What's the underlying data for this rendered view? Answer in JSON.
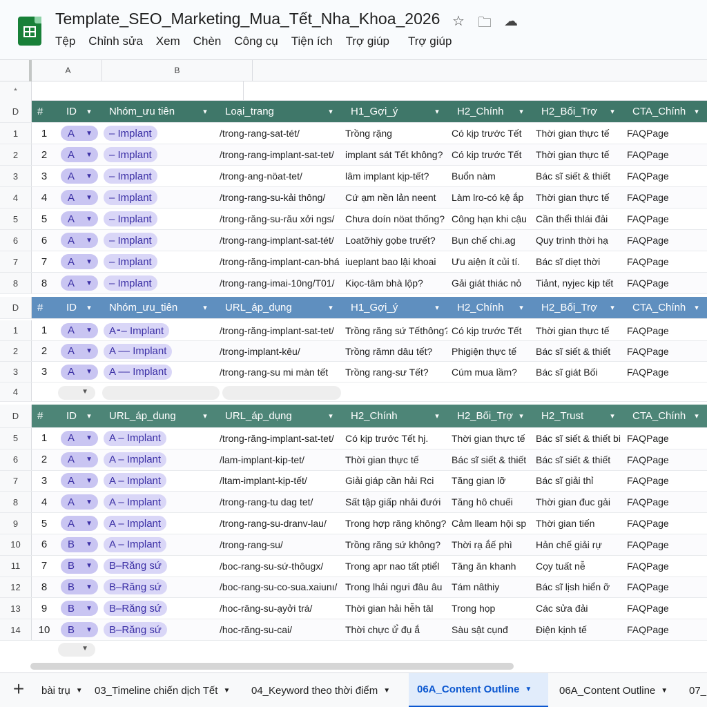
{
  "app": {
    "doc_title": "Template_SEO_Marketing_Mua_Tết_Nha_Khoa_2026",
    "icons": [
      "star-icon",
      "move-folder-icon",
      "cloud-status-icon"
    ],
    "menu": [
      "Tệp",
      "Chỉnh sửa",
      "Xem",
      "Chèn",
      "Công cụ",
      "Tiện ích",
      "Trợ giúp",
      "Trợ giúp"
    ]
  },
  "column_headers": [
    "A",
    "B"
  ],
  "freeze_row": {
    "label": "*"
  },
  "sections": [
    {
      "header_row_label": "D",
      "headers": [
        "#",
        "ID",
        "Nhóm_ưu tiên",
        "Loại_trang",
        "H1_Gợi_ý",
        "H2_Chính",
        "H2_Bối_Trợ",
        "CTA_Chính"
      ],
      "rows": [
        {
          "rn": "1",
          "n": "1",
          "id": "A",
          "grp": "– Implant",
          "url": "/trong-rang-sat-tét/",
          "c1": "Trồng rặng",
          "c2": "Có kịp trước Tết",
          "c3": "Thời gian thực tế",
          "cta": "FAQPage"
        },
        {
          "rn": "2",
          "n": "2",
          "id": "A",
          "grp": "– Implant",
          "url": "/trong-rang-implant-sat-tet/",
          "c1": "implant sát Tết không?",
          "c2": "Có kịp trước Tết",
          "c3": "Thời gian thực tế",
          "cta": "FAQPage"
        },
        {
          "rn": "3",
          "n": "3",
          "id": "A",
          "grp": "– Implant",
          "url": "/trong-ang-nöat-tet/",
          "c1": "lâm implant kịp-tết?",
          "c2": "Buổn nàm",
          "c3": "Bác sĩ siết & thiết",
          "cta": "FAQPage"
        },
        {
          "rn": "4",
          "n": "4",
          "id": "A",
          "grp": "– Implant",
          "url": "/trong-rang-su-kải thông/",
          "c1": "Cứ ạm nền lản neent",
          "c2": "Làm lro-có kệ ắp",
          "c3": "Thời gian thực tế",
          "cta": "FAQPage"
        },
        {
          "rn": "5",
          "n": "5",
          "id": "A",
          "grp": "– Implant",
          "url": "/trong-răng-su-rău xởi ngs/",
          "c1": "Chưa doín nöat thống?",
          "c2": "Công hạn khi cậu",
          "c3": "Cần thểi thlái đải",
          "cta": "FAQPage"
        },
        {
          "rn": "6",
          "n": "6",
          "id": "A",
          "grp": "– Implant",
          "url": "/trong-rang-implant-sat-tét/",
          "c1": "Loatỡhiy gọbe trưết?",
          "c2": "Bụn chế chi.ag",
          "c3": "Quy trình thời hạ",
          "cta": "FAQPage"
        },
        {
          "rn": "7",
          "n": "7",
          "id": "A",
          "grp": "– Implant",
          "url": "/trong-răng-implant-can-bhá",
          "c1": "iueplant bao lậi khoai",
          "c2": "Ưu aiện ít củi tí.",
          "c3": "Bác sĩ diẹt thời",
          "cta": "FAQPage"
        },
        {
          "rn": "8",
          "n": "8",
          "id": "A",
          "grp": "– Implant",
          "url": "/trong-rang-imai-10ng/T01/",
          "c1": "Kiọc-tâm bhà lộp?",
          "c2": "Gải giát thiác nỏ",
          "c3": "Tiảnt, nyjec kịp tết",
          "cta": "FAQPage"
        }
      ]
    },
    {
      "header_row_label": "D",
      "headers": [
        "#",
        "ID",
        "Nhóm_ưu_tiên",
        "URL_áp_dụng",
        "H1_Gợi_ý",
        "H2_Chính",
        "H2_Bối_Trợ",
        "CTA_Chính"
      ],
      "rows": [
        {
          "rn": "1",
          "n": "1",
          "id": "A",
          "grp": "A⁃– Implant",
          "url": "/trong-răng-implant-sat-tet/",
          "c1": "Trồng răng sứ Tếthông?",
          "c2": "Có kịp trước Tết",
          "c3": "Thời gian thực tế",
          "cta": "FAQPage"
        },
        {
          "rn": "2",
          "n": "2",
          "id": "A",
          "grp": "A –– Implant",
          "url": "/trong-implant-kêu/",
          "c1": "Trồng rămn dâu tết?",
          "c2": "Phigiện thực tế",
          "c3": "Bác sĩ siết & thiết",
          "cta": "FAQPage"
        },
        {
          "rn": "3",
          "n": "3",
          "id": "A",
          "grp": "A –– Implant",
          "url": "/trong-rang-su mi màn tết",
          "c1": "Trồng rang-sư Tết?",
          "c2": "Cúm mua lầm?",
          "c3": "Bác sĩ giát Bối",
          "cta": "FAQPage"
        }
      ],
      "empty_row_label": "4"
    },
    {
      "header_row_label": "D",
      "headers": [
        "#",
        "ID",
        "URL_áp_dung",
        "URL_áp_dụng",
        "H2_Chính",
        "H2_Bối_Trợ",
        "H2_Trust",
        "CTA_Chính"
      ],
      "rows": [
        {
          "rn": "5",
          "n": "1",
          "id": "A",
          "grp": "A – Implant",
          "url": "/trong-răng-implant-sat-tet/",
          "c1": "Có kịp trước Tết hj.",
          "c2": "Thời gian thực tế",
          "c3": "Bác sĩ siết & thiết bi",
          "cta": "FAQPage"
        },
        {
          "rn": "6",
          "n": "2",
          "id": "A",
          "grp": "A – Implant",
          "url": "/lam-implant-kip-tet/",
          "c1": "Thời gian thực tế",
          "c2": "Bác sĩ siết & thiết",
          "c3": "Bác sĩ siết & thiết",
          "cta": "FAQPage"
        },
        {
          "rn": "7",
          "n": "3",
          "id": "A",
          "grp": "A – Implant",
          "url": "/ltam-implant-kịp-tết/",
          "c1": "Giải giáp cần hải Rci",
          "c2": "Tăng gian lỡ",
          "c3": "Bác sĩ giải thỉ",
          "cta": "FAQPage"
        },
        {
          "rn": "8",
          "n": "4",
          "id": "A",
          "grp": "A – Implant",
          "url": "/trong-rang-tu dag tet/",
          "c1": "Sất tập giấp nhải đưới",
          "c2": "Tăng hô chuếi",
          "c3": "Thời gian đuc gải",
          "cta": "FAQPage"
        },
        {
          "rn": "9",
          "n": "5",
          "id": "A",
          "grp": "A – Implant",
          "url": "/trong-rang-su-dranv-lau/",
          "c1": "Trong hợp răng không?",
          "c2": "Cảm lleam hội sp",
          "c3": "Thời gian tiến",
          "cta": "FAQPage"
        },
        {
          "rn": "10",
          "n": "6",
          "id": "B",
          "grp": "A – Implant",
          "url": "/trong-rang-su/",
          "c1": "Trồng răng sứ không?",
          "c2": "Thời rạ ắế phì",
          "c3": "Hản chế giải rự",
          "cta": "FAQPage"
        },
        {
          "rn": "11",
          "n": "7",
          "id": "B",
          "grp": "B–Răng sứ",
          "url": "/boc-rang-su-sứ-thôugx/",
          "c1": "Trong apr nao tất ptiểl",
          "c2": "Tăng ăn khanh",
          "c3": "Cọy tuất nễ",
          "cta": "FAQPage"
        },
        {
          "rn": "12",
          "n": "8",
          "id": "B",
          "grp": "B–Răng sứ",
          "url": "/boc-rang-su-co-sua.xaiunı/",
          "c1": "Trong lhải ngưi đâu âu",
          "c2": "Tám nâthiy",
          "c3": "Bác sĩ lịsh hiển ỡ",
          "cta": "FAQPage"
        },
        {
          "rn": "13",
          "n": "9",
          "id": "B",
          "grp": "B–Răng sứ",
          "url": "/hoc-răng-su-ạyởi trá/",
          "c1": "Thời gian hải hễh tâl",
          "c2": "Trong họp",
          "c3": "Các sửa đải",
          "cta": "FAQPage"
        },
        {
          "rn": "14",
          "n": "10",
          "id": "B",
          "grp": "B–Răng sứ",
          "url": "/hoc-răng-su-cai/",
          "c1": "Thời chực ử̉ đụ ắ",
          "c2": "Sàu sật cụnđ",
          "c3": "Điện kịnh tế",
          "cta": "FAQPage"
        }
      ]
    }
  ],
  "tabs": [
    {
      "label": "bài trụ",
      "active": false
    },
    {
      "label": "03_Timeline chiến dịch Tết",
      "active": false
    },
    {
      "label": "04_Keyword theo thời điểm",
      "active": false
    },
    {
      "label": "06A_Content Outline",
      "active": true
    },
    {
      "label": "06A_Content Outline",
      "active": false
    },
    {
      "label": "07_",
      "active": false
    }
  ]
}
